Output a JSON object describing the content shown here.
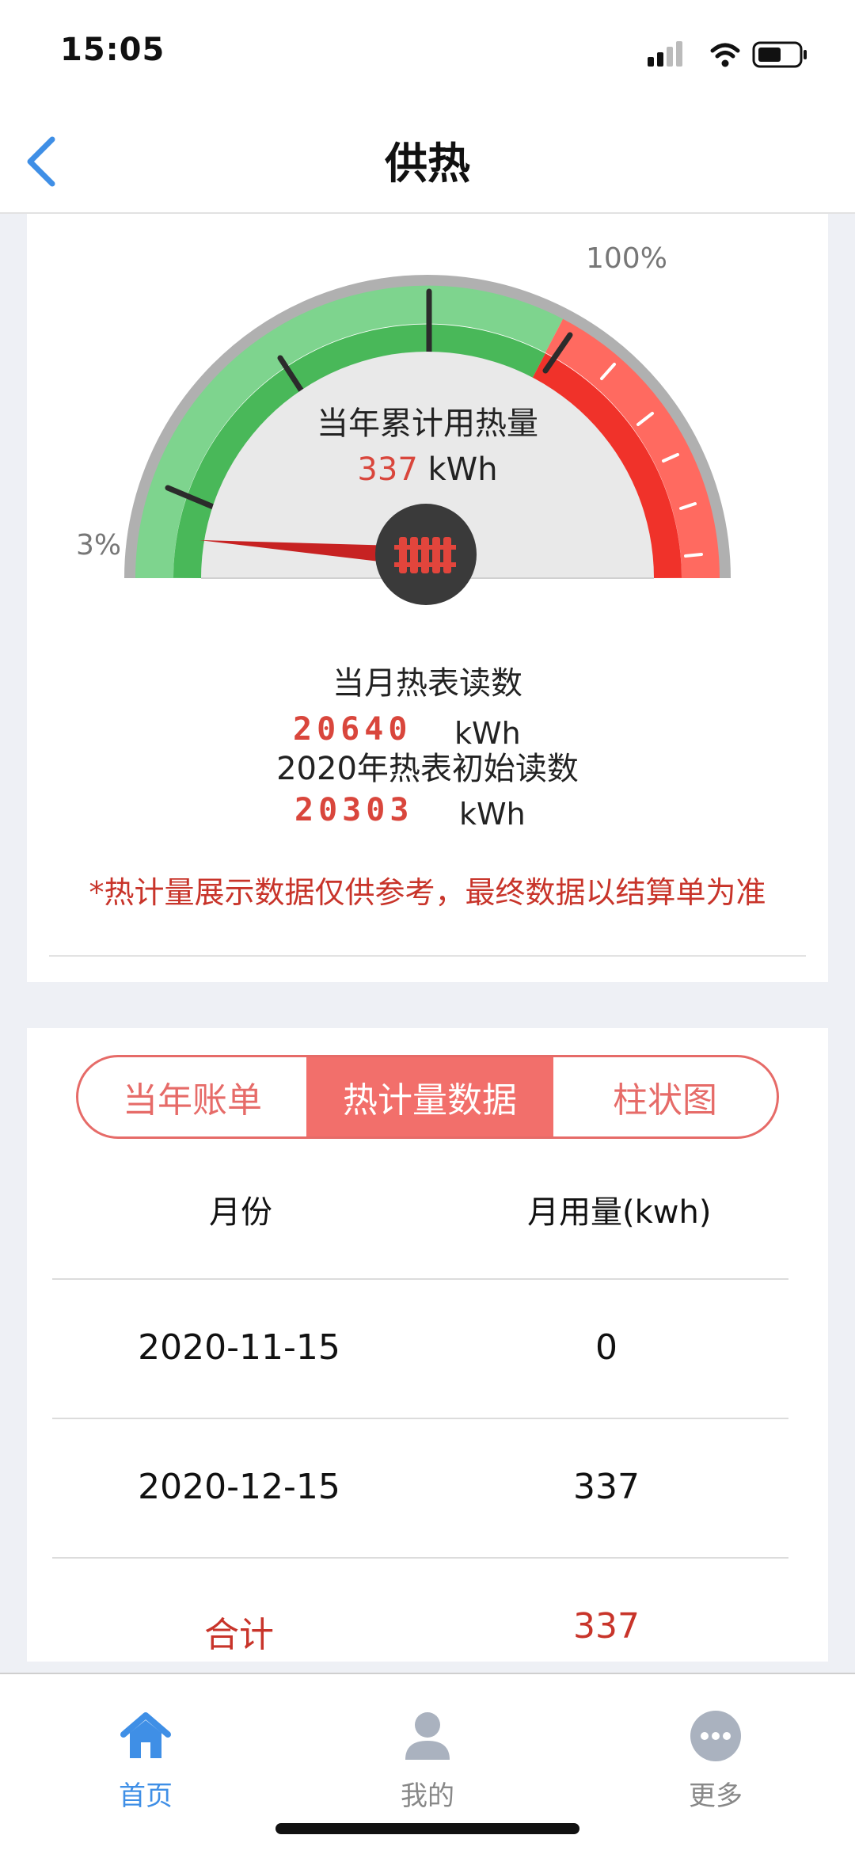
{
  "status": {
    "time": "15:05"
  },
  "header": {
    "title": "供热",
    "back_icon": "chevron-left-icon"
  },
  "gauge": {
    "title": "当年累计用热量",
    "value": "337",
    "unit": "kWh",
    "min_label": "3%",
    "max_label": "100%",
    "level_percent": 3,
    "center_icon": "radiator-icon",
    "colors": {
      "green": "#4cbb5c",
      "red": "#f0322a",
      "needle": "#c72222",
      "hub": "#3a3a3a"
    }
  },
  "meter": {
    "month_title": "当月热表读数",
    "month_value": "20640",
    "month_unit": "kWh",
    "initial_title": "2020年热表初始读数",
    "initial_value": "20303",
    "initial_unit": "kWh",
    "note": "*热计量展示数据仅供参考，最终数据以结算单为准"
  },
  "tabs": [
    {
      "label": "当年账单",
      "active": false
    },
    {
      "label": "热计量数据",
      "active": true
    },
    {
      "label": "柱状图",
      "active": false
    }
  ],
  "table": {
    "headers": [
      "月份",
      "月用量(kwh)"
    ],
    "rows": [
      {
        "month": "2020-11-15",
        "usage": "0"
      },
      {
        "month": "2020-12-15",
        "usage": "337"
      }
    ],
    "total": {
      "label": "合计",
      "value": "337"
    }
  },
  "tabbar": [
    {
      "label": "首页",
      "icon": "home-icon",
      "active": true
    },
    {
      "label": "我的",
      "icon": "user-icon",
      "active": false
    },
    {
      "label": "更多",
      "icon": "more-icon",
      "active": false
    }
  ]
}
